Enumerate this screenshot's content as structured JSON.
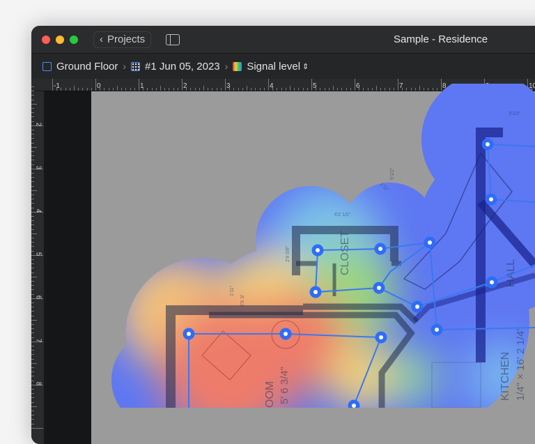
{
  "window": {
    "title": "Sample - Residence",
    "back_label": "Projects"
  },
  "breadcrumb": [
    {
      "label": "Ground Floor",
      "icon": "floor-plan-icon"
    },
    {
      "label": "#1 Jun 05, 2023",
      "icon": "survey-icon"
    },
    {
      "label": "Signal level",
      "icon": "heatmap-gradient-icon"
    }
  ],
  "ruler": {
    "horizontal": [
      "-1",
      "0",
      "1",
      "2",
      "3",
      "4",
      "5",
      "6",
      "7",
      "8",
      "9",
      "10"
    ],
    "vertical": [
      "2",
      "3",
      "4",
      "5",
      "6",
      "7",
      "8"
    ]
  },
  "plan_labels": {
    "closet": "CLOSET",
    "hall": "HALL",
    "kitchen": "KITCHEN",
    "kitchen_dim": "1/4\" × 16' 2 1/4\"",
    "room": "OOM",
    "room_dim": "5' 6 3/4\"",
    "closet_width": "6'2 1/2\"",
    "closet_depth": "2'8 5/8\"",
    "hall_dim": "5'1/2\"",
    "door_dim1": "2'8 3/",
    "door_dim2": "1'11\"",
    "stair_dim": "1'11\"",
    "top_dim": "3'1/2\""
  },
  "colors": {
    "accent": "#2f6df6",
    "red": "#ee7b6b",
    "yellow": "#f2d27a",
    "green": "#9ad67f",
    "blue": "#5e77f2"
  }
}
